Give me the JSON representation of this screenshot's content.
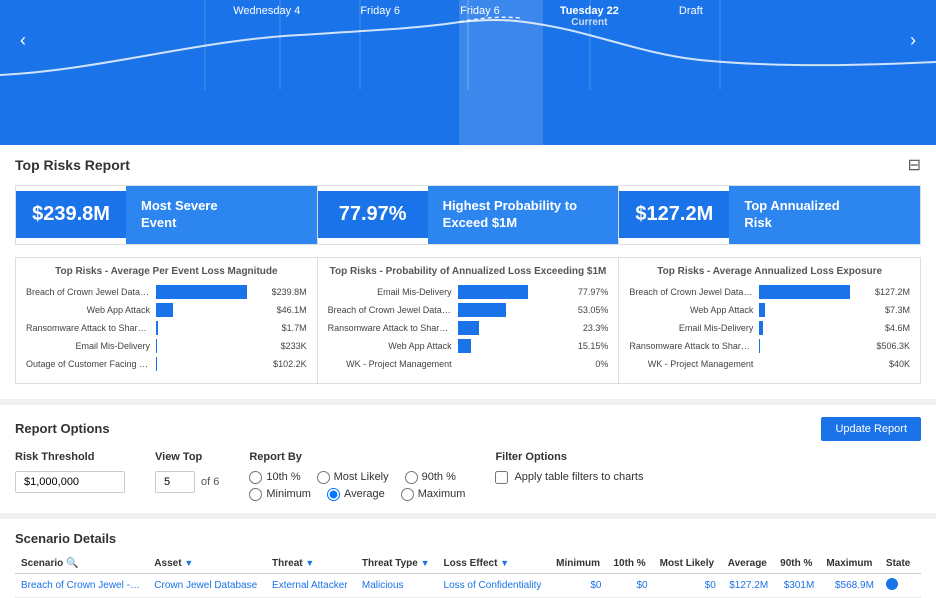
{
  "timeline": {
    "dates": [
      {
        "label": "Wednesday 4",
        "sub": ""
      },
      {
        "label": "Friday 6",
        "sub": ""
      },
      {
        "label": "Friday 6",
        "sub": ""
      },
      {
        "label": "Tuesday 22",
        "sub": "Current",
        "isCurrent": true
      },
      {
        "label": "Draft",
        "sub": ""
      }
    ],
    "prevArrow": "‹",
    "nextArrow": "›"
  },
  "topRisks": {
    "title": "Top Risks Report",
    "kpis": [
      {
        "value": "$239.8M",
        "label": "Most Severe\nEvent"
      },
      {
        "value": "77.97%",
        "label": "Highest Probability to\nExceed $1M"
      },
      {
        "value": "$127.2M",
        "label": "Top Annualized\nRisk"
      }
    ],
    "charts": [
      {
        "title": "Top Risks - Average Per Event Loss Magnitude",
        "rows": [
          {
            "label": "Breach of Crown Jewel Database - Exte...",
            "pct": 100,
            "value": "$239.8M"
          },
          {
            "label": "Web App Attack",
            "pct": 19,
            "value": "$46.1M"
          },
          {
            "label": "Ransomware Attack to Shared Drives",
            "pct": 0.7,
            "value": "$1.7M"
          },
          {
            "label": "Email Mis-Delivery",
            "pct": 0.1,
            "value": "$233K"
          },
          {
            "label": "Outage of Customer Facing Website",
            "pct": 0.04,
            "value": "$102.2K"
          }
        ]
      },
      {
        "title": "Top Risks - Probability of Annualized Loss Exceeding $1M",
        "rows": [
          {
            "label": "Email Mis-Delivery",
            "pct": 78,
            "value": "77.97%"
          },
          {
            "label": "Breach of Crown Jewel Database - Exte...",
            "pct": 53,
            "value": "53.05%"
          },
          {
            "label": "Ransomware Attack to Shared Drives",
            "pct": 23,
            "value": "23.3%"
          },
          {
            "label": "Web App Attack",
            "pct": 15,
            "value": "15.15%"
          },
          {
            "label": "WK - Project Management",
            "pct": 0,
            "value": "0%"
          }
        ]
      },
      {
        "title": "Top Risks - Average Annualized Loss Exposure",
        "rows": [
          {
            "label": "Breach of Crown Jewel Database - Exte...",
            "pct": 100,
            "value": "$127.2M"
          },
          {
            "label": "Web App Attack",
            "pct": 6,
            "value": "$7.3M"
          },
          {
            "label": "Email Mis-Delivery",
            "pct": 4,
            "value": "$4.6M"
          },
          {
            "label": "Ransomware Attack to Shared Drives",
            "pct": 0.4,
            "value": "$506.3K"
          },
          {
            "label": "WK - Project Management",
            "pct": 0.03,
            "value": "$40K"
          }
        ]
      }
    ]
  },
  "reportOptions": {
    "title": "Report Options",
    "updateBtn": "Update Report",
    "riskThreshold": {
      "label": "Risk Threshold",
      "value": "$1,000,000"
    },
    "viewTop": {
      "label": "View Top",
      "value": "5",
      "of": "of 6"
    },
    "reportBy": {
      "label": "Report By",
      "options": [
        "10th %",
        "Most Likely",
        "90th %",
        "Minimum",
        "Average",
        "Maximum"
      ],
      "selected": "Average"
    },
    "filterOptions": {
      "label": "Filter Options",
      "checkboxLabel": "Apply table filters to charts",
      "checked": false
    }
  },
  "scenarioDetails": {
    "title": "Scenario Details",
    "columns": [
      {
        "key": "scenario",
        "label": "Scenario",
        "hasSearch": true
      },
      {
        "key": "asset",
        "label": "Asset",
        "hasFilter": true
      },
      {
        "key": "threat",
        "label": "Threat",
        "hasFilter": true
      },
      {
        "key": "threatType",
        "label": "Threat Type",
        "hasFilter": true
      },
      {
        "key": "lossEffect",
        "label": "Loss Effect",
        "hasFilter": true
      },
      {
        "key": "minimum",
        "label": "Minimum"
      },
      {
        "key": "tenth",
        "label": "10th %"
      },
      {
        "key": "mostLikely",
        "label": "Most Likely"
      },
      {
        "key": "average",
        "label": "Average"
      },
      {
        "key": "ninetieth",
        "label": "90th %"
      },
      {
        "key": "maximum",
        "label": "Maximum"
      },
      {
        "key": "state",
        "label": "State"
      }
    ],
    "rows": [
      {
        "scenario": "Breach of Crown Jewel - External",
        "asset": "Crown Jewel Database",
        "threat": "External Attacker",
        "threatType": "Malicious",
        "lossEffect": "Loss of Confidentiality",
        "minimum": "$0",
        "tenth": "$0",
        "mostLikely": "$0",
        "average": "$127.2M",
        "ninetieth": "$301M",
        "maximum": "$568.9M",
        "state": ""
      }
    ]
  }
}
